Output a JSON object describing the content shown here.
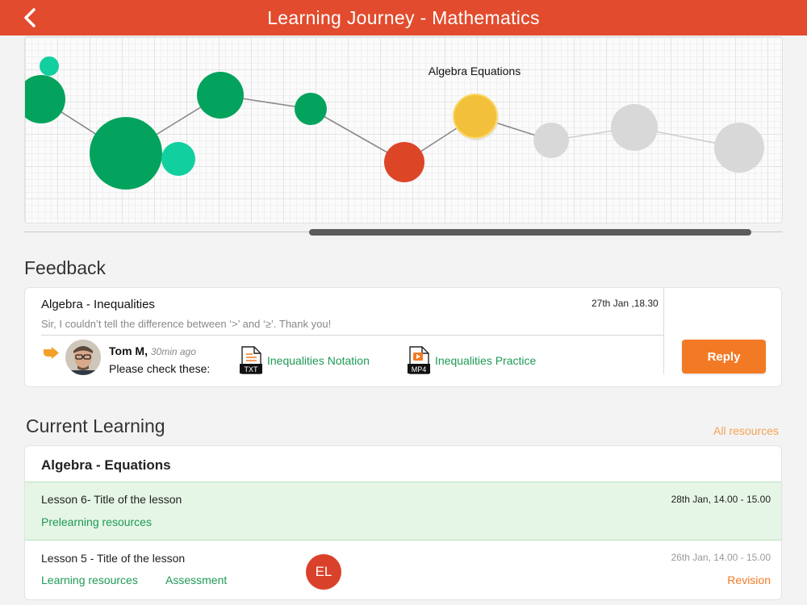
{
  "header": {
    "title": "Learning Journey - Mathematics",
    "back_icon": "chevron-left-icon"
  },
  "journey": {
    "highlight_label": "Algebra Equations",
    "colors": {
      "mastered": "#04a35d",
      "minor": "#12cfa0",
      "current": "#f2c03a",
      "struggling": "#dd4527",
      "upcoming": "#d8d8d8",
      "link": "#8a8a8a"
    }
  },
  "feedback": {
    "heading": "Feedback",
    "subject": "Algebra - Inequalities",
    "date": "27th Jan ,18.30",
    "message": "Sir, I couldn’t tell the difference between ‘>’ and ‘≥’. Thank you!",
    "teacher": {
      "name": "Tom M,",
      "time": "30min ago",
      "prompt": "Please check these:"
    },
    "files": [
      {
        "type": "TXT",
        "name": "Inequalities Notation",
        "icon": "txt-file-icon"
      },
      {
        "type": "MP4",
        "name": "Inequalities Practice",
        "icon": "mp4-file-icon"
      }
    ],
    "reply_label": "Reply"
  },
  "current_learning": {
    "heading": "Current Learning",
    "all_resources_label": "All resources",
    "topic": "Algebra - Equations",
    "lessons": [
      {
        "title": "Lesson 6- Title of the lesson",
        "date": "28th Jan, 14.00 - 15.00",
        "links": [
          "Prelearning resources"
        ]
      },
      {
        "title": "Lesson 5 - Title of the lesson",
        "date": "26th Jan, 14.00 - 15.00",
        "links": [
          "Learning resources",
          "Assessment"
        ],
        "badge": "EL",
        "action": "Revision"
      }
    ]
  }
}
